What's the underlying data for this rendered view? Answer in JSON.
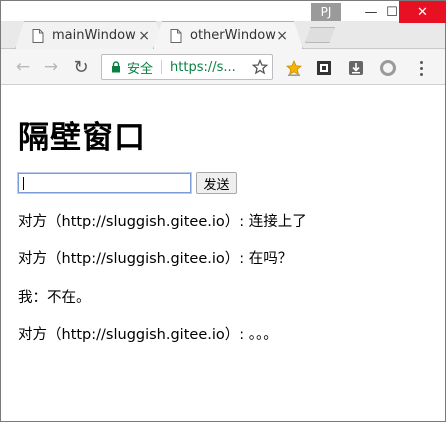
{
  "window": {
    "profile_badge": "PJ",
    "controls": {
      "minimize": "—",
      "maximize": "☐",
      "close": "✕"
    }
  },
  "tabs": [
    {
      "label": "mainWindow",
      "close": "×"
    },
    {
      "label": "otherWindow",
      "close": "×",
      "active": true
    }
  ],
  "toolbar": {
    "back": "←",
    "forward": "→",
    "reload": "↻",
    "secure_label": "安全",
    "url": "https://s...",
    "icons": [
      "star-icon",
      "bookmark-star-extension-icon",
      "qr-extension-icon",
      "download-extension-icon",
      "circle-extension-icon",
      "menu-icon"
    ]
  },
  "page": {
    "title": "隔壁窗口",
    "input": {
      "value": "",
      "placeholder": ""
    },
    "send_label": "发送",
    "messages": [
      "对方（http://sluggish.gitee.io）: 连接上了",
      "对方（http://sluggish.gitee.io）: 在吗？",
      "我：不在。",
      "对方（http://sluggish.gitee.io）: 。。。"
    ]
  },
  "colors": {
    "secure_green": "#0b8043",
    "close_red": "#e81123",
    "star_gold": "#f4b400"
  }
}
